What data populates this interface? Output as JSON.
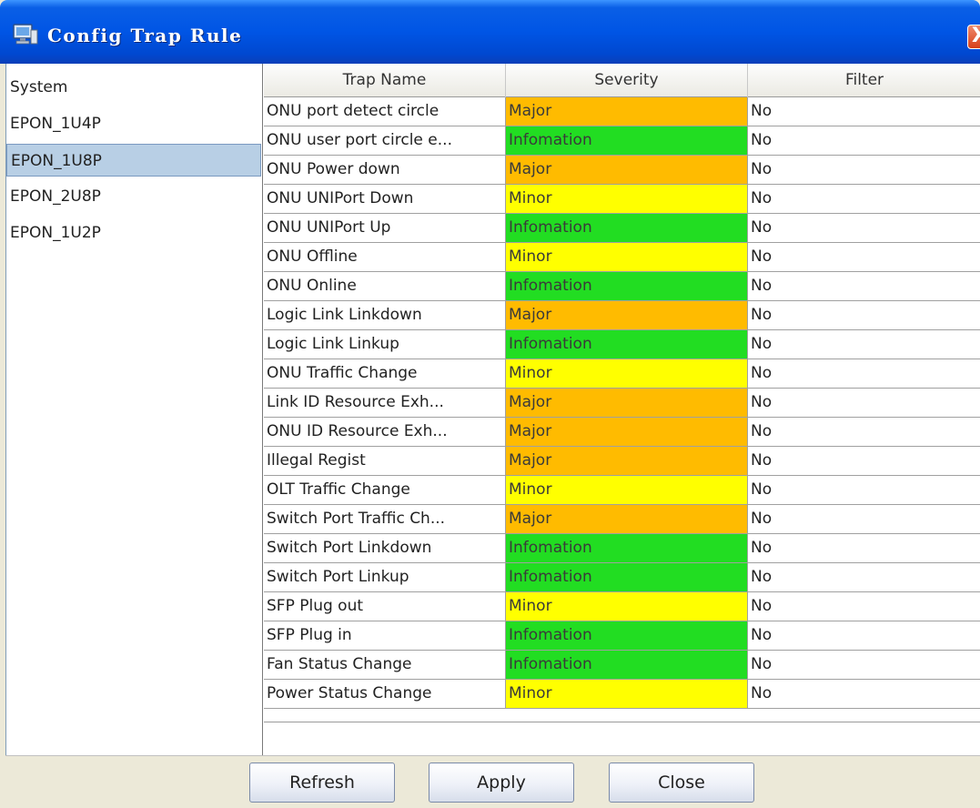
{
  "window": {
    "title": "Config Trap Rule",
    "close_label": "X"
  },
  "device_list": [
    {
      "label": "System",
      "selected": false
    },
    {
      "label": "EPON_1U4P",
      "selected": false
    },
    {
      "label": "EPON_1U8P",
      "selected": true
    },
    {
      "label": "EPON_2U8P",
      "selected": false
    },
    {
      "label": "EPON_1U2P",
      "selected": false
    }
  ],
  "table": {
    "columns": [
      "Trap Name",
      "Severity",
      "Filter"
    ],
    "rows": [
      {
        "name": "ONU port detect circle",
        "severity": "Major",
        "filter": "No"
      },
      {
        "name": "ONU user port circle e...",
        "severity": "Infomation",
        "filter": "No"
      },
      {
        "name": "ONU Power down",
        "severity": "Major",
        "filter": "No"
      },
      {
        "name": "ONU UNIPort Down",
        "severity": "Minor",
        "filter": "No"
      },
      {
        "name": "ONU UNIPort Up",
        "severity": "Infomation",
        "filter": "No"
      },
      {
        "name": "ONU Offline",
        "severity": "Minor",
        "filter": "No"
      },
      {
        "name": "ONU Online",
        "severity": "Infomation",
        "filter": "No"
      },
      {
        "name": "Logic Link Linkdown",
        "severity": "Major",
        "filter": "No"
      },
      {
        "name": "Logic Link Linkup",
        "severity": "Infomation",
        "filter": "No"
      },
      {
        "name": "ONU Traffic Change",
        "severity": "Minor",
        "filter": "No"
      },
      {
        "name": "Link ID Resource Exh...",
        "severity": "Major",
        "filter": "No"
      },
      {
        "name": "ONU ID Resource Exh...",
        "severity": "Major",
        "filter": "No"
      },
      {
        "name": "Illegal Regist",
        "severity": "Major",
        "filter": "No"
      },
      {
        "name": "OLT Traffic Change",
        "severity": "Minor",
        "filter": "No"
      },
      {
        "name": "Switch Port Traffic Ch...",
        "severity": "Major",
        "filter": "No"
      },
      {
        "name": "Switch Port Linkdown",
        "severity": "Infomation",
        "filter": "No"
      },
      {
        "name": "Switch Port Linkup",
        "severity": "Infomation",
        "filter": "No"
      },
      {
        "name": "SFP Plug out",
        "severity": "Minor",
        "filter": "No"
      },
      {
        "name": "SFP Plug in",
        "severity": "Infomation",
        "filter": "No"
      },
      {
        "name": "Fan Status Change",
        "severity": "Infomation",
        "filter": "No"
      },
      {
        "name": "Power Status Change",
        "severity": "Minor",
        "filter": "No"
      }
    ]
  },
  "severity_colors": {
    "Major": "#ffbb00",
    "Minor": "#ffff00",
    "Infomation": "#22dd22"
  },
  "buttons": {
    "refresh": "Refresh",
    "apply": "Apply",
    "close": "Close"
  }
}
